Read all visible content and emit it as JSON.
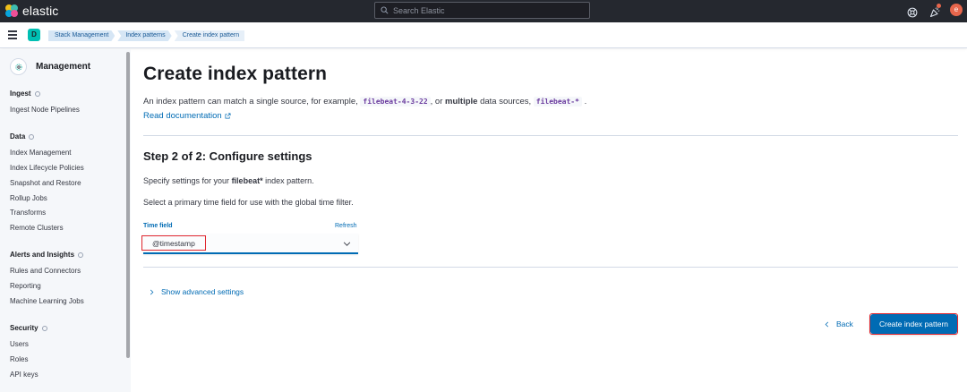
{
  "topbar": {
    "brand": "elastic",
    "search_placeholder": "Search Elastic",
    "user_initial": "e"
  },
  "breadcrumbs": {
    "space_initial": "D",
    "items": [
      "Stack Management",
      "Index patterns",
      "Create index pattern"
    ]
  },
  "sidebar": {
    "title": "Management",
    "groups": [
      {
        "label": "Ingest",
        "items": [
          "Ingest Node Pipelines"
        ]
      },
      {
        "label": "Data",
        "items": [
          "Index Management",
          "Index Lifecycle Policies",
          "Snapshot and Restore",
          "Rollup Jobs",
          "Transforms",
          "Remote Clusters"
        ]
      },
      {
        "label": "Alerts and Insights",
        "items": [
          "Rules and Connectors",
          "Reporting",
          "Machine Learning Jobs"
        ]
      },
      {
        "label": "Security",
        "items": [
          "Users",
          "Roles",
          "API keys"
        ]
      }
    ]
  },
  "main": {
    "title": "Create index pattern",
    "desc_part1": "An index pattern can match a single source, for example,",
    "code1": "filebeat-4-3-22",
    "desc_part2": ", or",
    "desc_bold": "multiple",
    "desc_part3": "data sources,",
    "code2": "filebeat-*",
    "desc_part4": ".",
    "read_doc": "Read documentation",
    "step_title": "Step 2 of 2: Configure settings",
    "specify_part1": "Specify settings for your",
    "specify_bold": "filebeat*",
    "specify_part2": "index pattern.",
    "select_primary": "Select a primary time field for use with the global time filter.",
    "time_field_label": "Time field",
    "refresh": "Refresh",
    "time_field_value": "@timestamp",
    "advanced": "Show advanced settings",
    "back": "Back",
    "create": "Create index pattern"
  },
  "colors": {
    "accent": "#006bb4",
    "header_bg": "#25282f",
    "highlight": "#e0262e"
  }
}
